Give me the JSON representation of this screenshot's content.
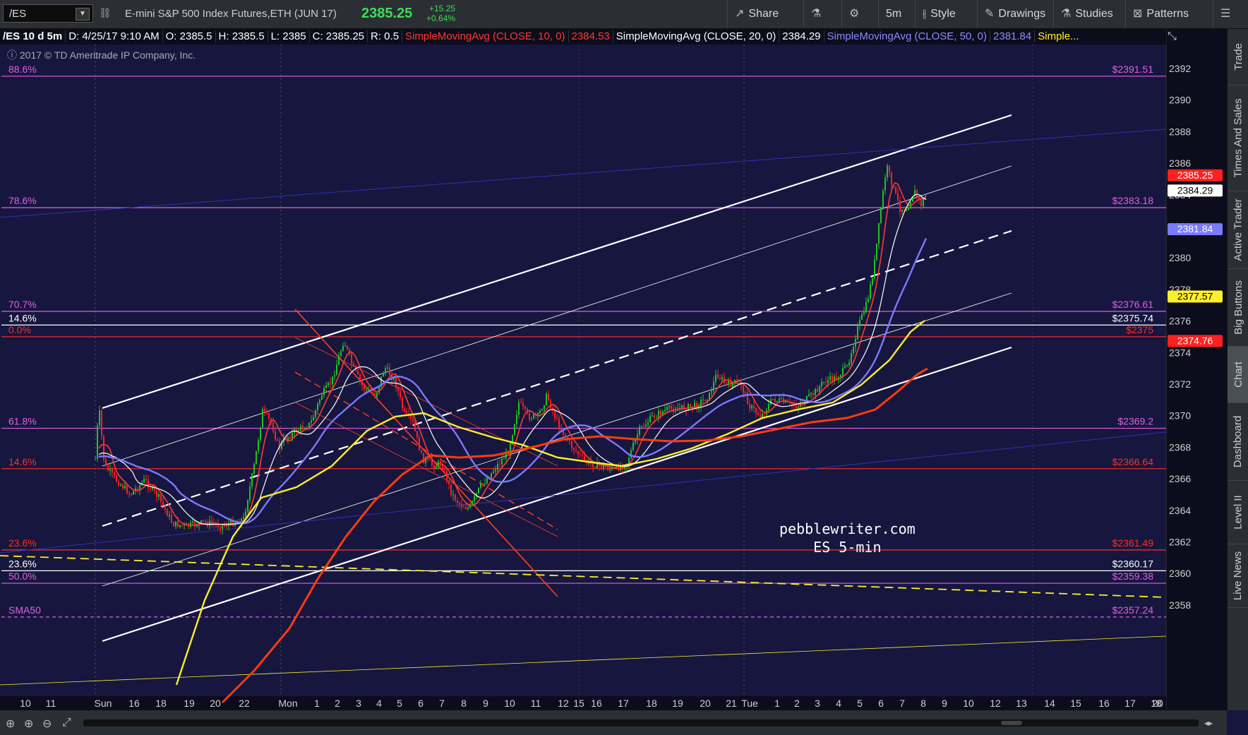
{
  "toolbar": {
    "symbol": "/ES",
    "description": "E-mini S&P 500 Index Futures,ETH (JUN 17)",
    "last": "2385.25",
    "change": "+15.25",
    "change_pct": "+0.64%",
    "share": "Share",
    "interval": "5m",
    "style": "Style",
    "drawings": "Drawings",
    "studies": "Studies",
    "patterns": "Patterns"
  },
  "infobar": {
    "symbol_period": "/ES 10 d 5m",
    "date": "D: 4/25/17 9:10 AM",
    "open": "O: 2385.5",
    "high": "H: 2385.5",
    "low": "L: 2385",
    "close": "C: 2385.25",
    "range": "R: 0.5",
    "sma10_label": "SimpleMovingAvg (CLOSE, 10, 0)",
    "sma10_value": "2384.53",
    "sma20_label": "SimpleMovingAvg (CLOSE, 20, 0)",
    "sma20_value": "2384.29",
    "sma50_label": "SimpleMovingAvg (CLOSE, 50, 0)",
    "sma50_value": "2381.84",
    "more": "Simple..."
  },
  "copyright": "2017 © TD Ameritrade IP Company, Inc.",
  "watermark": {
    "line1": "pebblewriter.com",
    "line2": "ES 5-min"
  },
  "colors": {
    "background": "#16163f",
    "sma10": "#ff3a2a",
    "sma20": "#ffffff",
    "sma50": "#7a7aff",
    "sma200_like": "#ffee2a",
    "sma_red_thick": "#ff3a10",
    "fib": "#e060e0",
    "up_candle": "#22c222",
    "down_candle": "#ff2020"
  },
  "side_tabs": [
    "Trade",
    "Times And Sales",
    "Active Trader",
    "Big Buttons",
    "Chart",
    "Dashboard",
    "Level II",
    "Live News"
  ],
  "chart_data": {
    "type": "candlestick",
    "y_axis": {
      "min": 2356,
      "max": 2393.5,
      "ticks": [
        2358,
        2360,
        2362,
        2364,
        2366,
        2368,
        2370,
        2372,
        2374,
        2376,
        2378,
        2380,
        2382,
        2384,
        2386,
        2388,
        2390,
        2392
      ]
    },
    "x_axis": {
      "ticks": [
        "10",
        "11",
        "Sun",
        "16",
        "18",
        "19",
        "20",
        "22",
        "Mon",
        "1",
        "2",
        "3",
        "4",
        "5",
        "6",
        "7",
        "8",
        "9",
        "10",
        "11",
        "12",
        "15",
        "16",
        "17",
        "18",
        "19",
        "20",
        "21",
        "Tue",
        "1",
        "2",
        "3",
        "4",
        "5",
        "6",
        "7",
        "8",
        "9",
        "10",
        "12",
        "13",
        "14",
        "15",
        "16",
        "17",
        "18",
        "20"
      ]
    },
    "price_badges": [
      {
        "value": "2385.25",
        "price": 2385.25,
        "bg": "#ff2020",
        "fg": "#ffffff"
      },
      {
        "value": "2384.29",
        "price": 2384.29,
        "bg": "#ffffff",
        "fg": "#000000"
      },
      {
        "value": "2381.84",
        "price": 2381.84,
        "bg": "#7a7aff",
        "fg": "#ffffff"
      },
      {
        "value": "2377.57",
        "price": 2377.57,
        "bg": "#ffee2a",
        "fg": "#000000"
      },
      {
        "value": "2374.76",
        "price": 2374.76,
        "bg": "#ff2020",
        "fg": "#ffffff"
      }
    ],
    "levels": [
      {
        "pct": "88.6%",
        "price": 2391.51,
        "label": "$2391.51",
        "color": "#e060e0"
      },
      {
        "pct": "78.6%",
        "price": 2383.18,
        "label": "$2383.18",
        "color": "#e060e0"
      },
      {
        "pct": "70.7%",
        "price": 2376.61,
        "label": "$2376.61",
        "color": "#e060e0"
      },
      {
        "pct": "14.6%",
        "price": 2375.74,
        "label": "$2375.74",
        "color": "#ffffff"
      },
      {
        "pct": "0.0%",
        "price": 2375.0,
        "label": "$2375",
        "color": "#ff3020"
      },
      {
        "pct": "61.8%",
        "price": 2369.2,
        "label": "$2369.2",
        "color": "#e060e0"
      },
      {
        "pct": "14.6%",
        "price": 2366.64,
        "label": "$2366.64",
        "color": "#ff3020"
      },
      {
        "pct": "23.6%",
        "price": 2361.49,
        "label": "$2361.49",
        "color": "#ff3020"
      },
      {
        "pct": "23.6%",
        "price": 2360.17,
        "label": "$2360.17",
        "color": "#ffffff"
      },
      {
        "pct": "50.0%",
        "price": 2359.38,
        "label": "$2359.38",
        "color": "#e060e0"
      },
      {
        "pct": "SMA50",
        "price": 2357.24,
        "label": "$2357.24",
        "color": "#e060e0",
        "dashed": true
      }
    ]
  }
}
